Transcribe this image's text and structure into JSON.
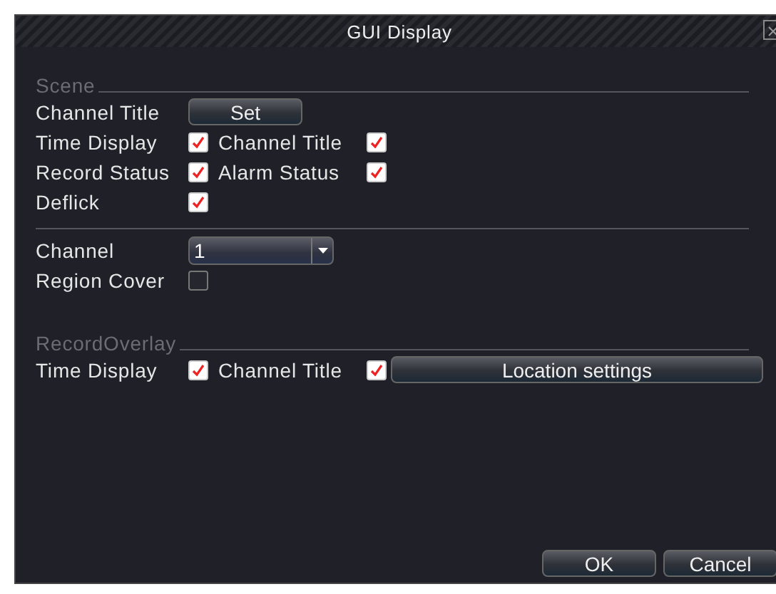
{
  "window": {
    "title": "GUI Display"
  },
  "scene": {
    "heading": "Scene",
    "channel_title_label": "Channel Title",
    "set_button": "Set",
    "options": [
      {
        "label": "Time Display",
        "checked": true
      },
      {
        "label": "Channel Title",
        "checked": true
      },
      {
        "label": "Record Status",
        "checked": true
      },
      {
        "label": "Alarm Status",
        "checked": true
      },
      {
        "label": "Deflick",
        "checked": true
      }
    ]
  },
  "channel": {
    "label": "Channel",
    "value": "1"
  },
  "region_cover": {
    "label": "Region Cover",
    "checked": false
  },
  "record_overlay": {
    "heading": "RecordOverlay",
    "options": [
      {
        "label": "Time Display",
        "checked": true
      },
      {
        "label": "Channel Title",
        "checked": true
      }
    ],
    "location_button": "Location settings"
  },
  "buttons": [
    "OK",
    "Cancel"
  ]
}
